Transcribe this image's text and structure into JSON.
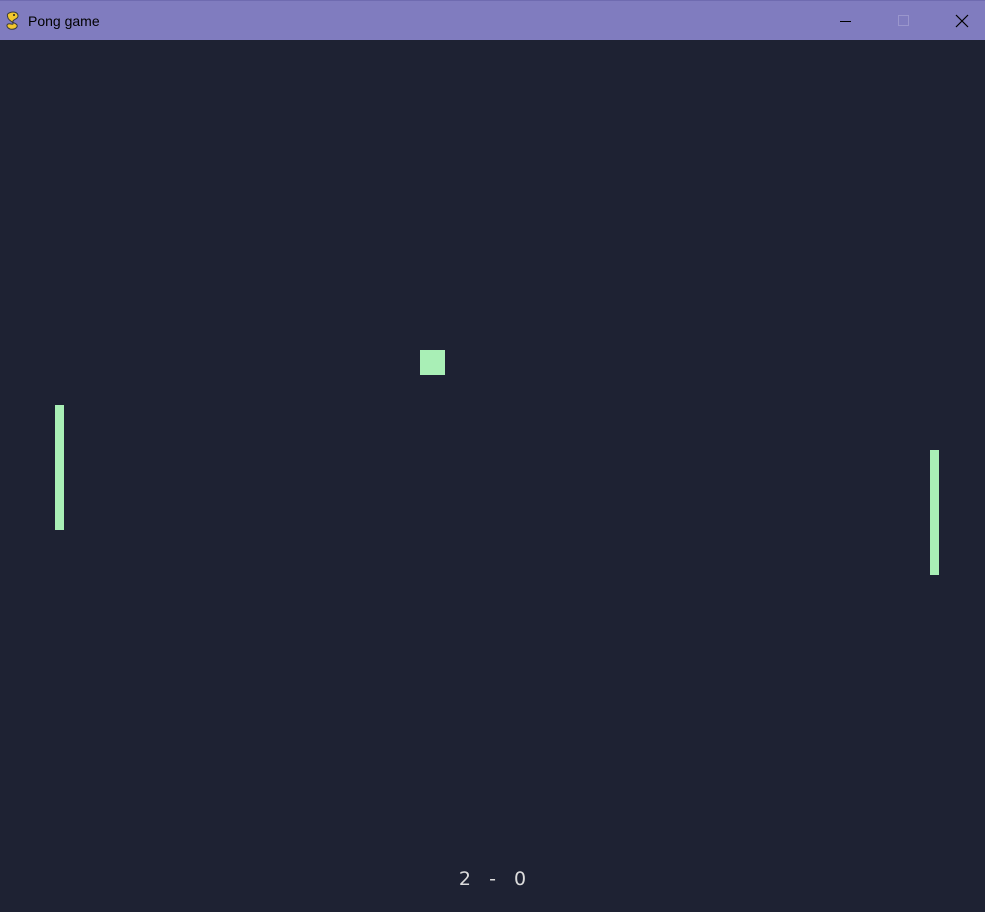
{
  "window": {
    "title": "Pong game",
    "icon": "pygame-snake-icon",
    "controls": {
      "minimize": "minimize-icon",
      "maximize": "maximize-icon",
      "close": "close-icon"
    }
  },
  "game": {
    "score": {
      "left": "2",
      "separator": "-",
      "right": "0"
    },
    "colors": {
      "background": "#1e2233",
      "titlebar": "#807cbf",
      "paddles_and_ball": "#a9efb6",
      "score_text": "#dcdcdc"
    }
  }
}
